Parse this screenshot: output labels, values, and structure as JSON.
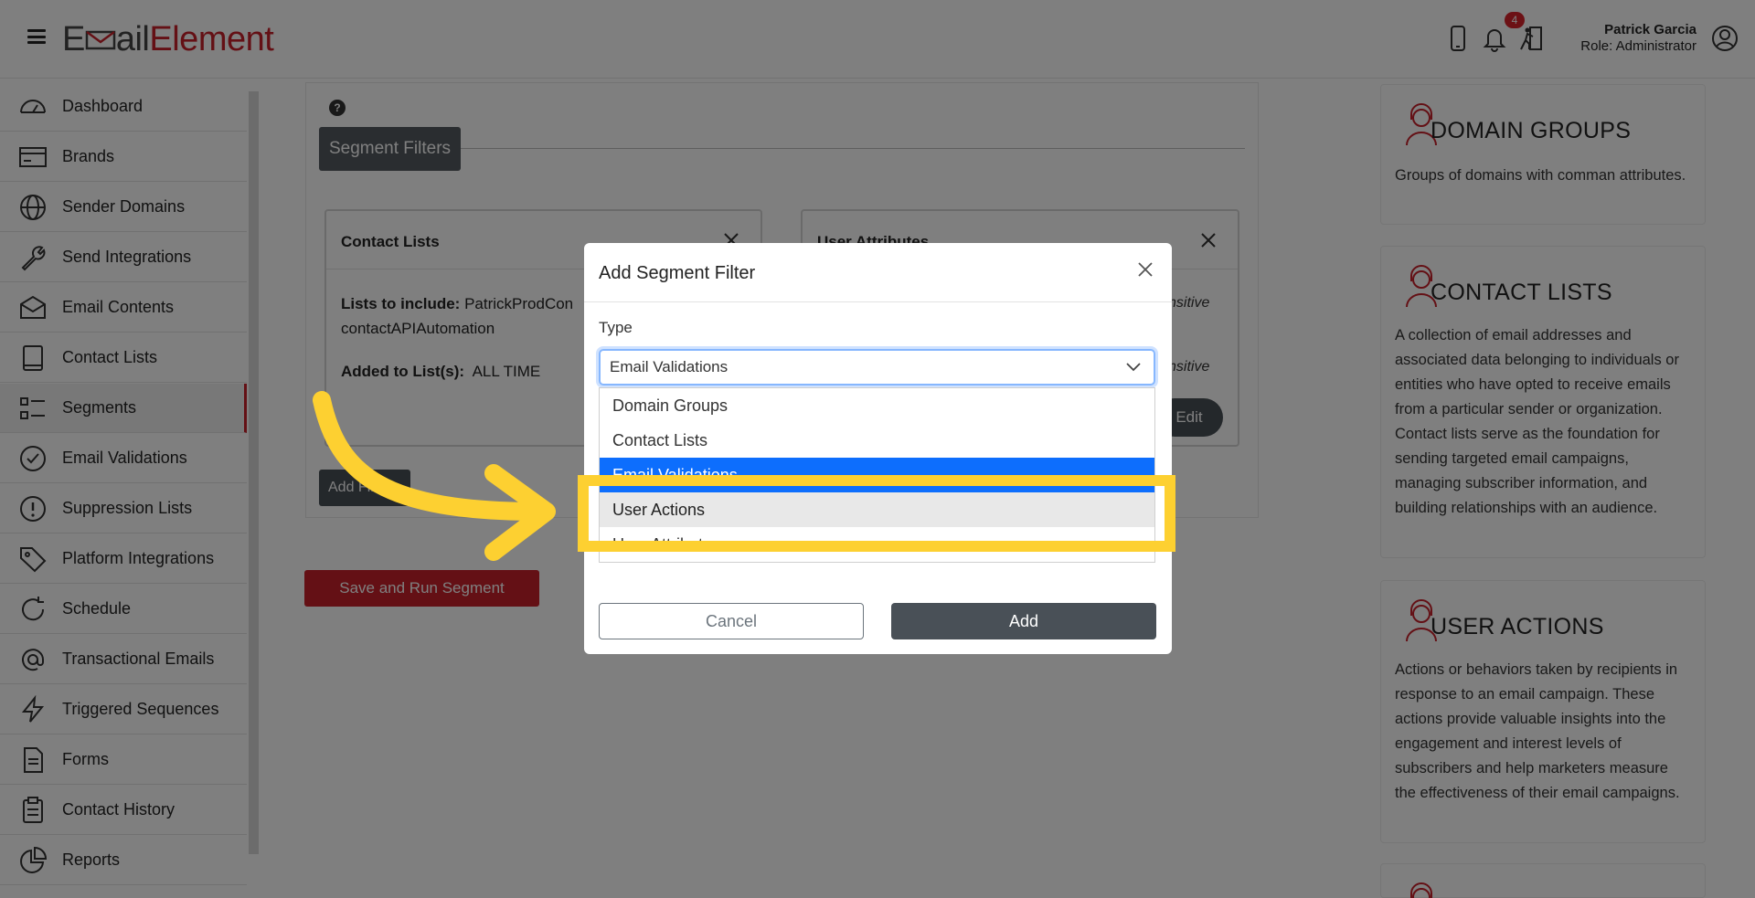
{
  "header": {
    "logo_part1": "E",
    "logo_part2": "ail",
    "logo_part3": "Element",
    "notification_count": "4",
    "user_name": "Patrick Garcia",
    "user_role": "Role: Administrator",
    "icons": [
      "phone-icon",
      "bell-icon",
      "exit-icon",
      "user-circle-icon"
    ]
  },
  "sidebar": {
    "items": [
      {
        "label": "Dashboard",
        "icon": "gauge-icon"
      },
      {
        "label": "Brands",
        "icon": "card-icon"
      },
      {
        "label": "Sender Domains",
        "icon": "globe-icon"
      },
      {
        "label": "Send Integrations",
        "icon": "wrench-icon"
      },
      {
        "label": "Email Contents",
        "icon": "envelope-icon"
      },
      {
        "label": "Contact Lists",
        "icon": "book-icon"
      },
      {
        "label": "Segments",
        "icon": "list-icon"
      },
      {
        "label": "Email Validations",
        "icon": "check-circle-icon"
      },
      {
        "label": "Suppression Lists",
        "icon": "exclamation-circle-icon"
      },
      {
        "label": "Platform Integrations",
        "icon": "tag-icon"
      },
      {
        "label": "Schedule",
        "icon": "refresh-icon"
      },
      {
        "label": "Transactional Emails",
        "icon": "at-icon"
      },
      {
        "label": "Triggered Sequences",
        "icon": "lightning-icon"
      },
      {
        "label": "Forms",
        "icon": "document-icon"
      },
      {
        "label": "Contact History",
        "icon": "clipboard-icon"
      },
      {
        "label": "Reports",
        "icon": "pie-chart-icon"
      }
    ],
    "active": "Segments"
  },
  "main": {
    "help": "?",
    "tab_label": "Segment Filters",
    "contact_card": {
      "title": "Contact Lists",
      "lists_label": "Lists to include:",
      "lists_value": "PatrickProdCon",
      "lists_value2": "contactAPIAutomation",
      "added_label": "Added to List(s):",
      "added_value": "ALL TIME"
    },
    "attr_card": {
      "title": "User Attributes",
      "sensitive1": "nsitive",
      "sensitive2": "nsitive",
      "edit_label": "Edit"
    },
    "add_filter_label": "Add Filter",
    "save_run_label": "Save and Run Segment"
  },
  "right_panel": {
    "cards": [
      {
        "title": "DOMAIN GROUPS",
        "body": "Groups of domains with comman attributes."
      },
      {
        "title": "CONTACT LISTS",
        "body": "A collection of email addresses and associated data belonging to individuals or entities who have opted to receive emails from a particular sender or organization. Contact lists serve as the foundation for sending targeted email campaigns, managing subscriber information, and building relationships with an audience."
      },
      {
        "title": "USER ACTIONS",
        "body": "Actions or behaviors taken by recipients in response to an email campaign. These actions provide valuable insights into the engagement and interest levels of subscribers and help marketers measure the effectiveness of their email campaigns."
      }
    ]
  },
  "modal": {
    "title": "Add Segment Filter",
    "type_label": "Type",
    "selected_value": "Email Validations",
    "options": [
      "Domain Groups",
      "Contact Lists",
      "Email Validations",
      "User Actions",
      "User Attributes"
    ],
    "highlighted_option": "User Actions",
    "cancel_label": "Cancel",
    "add_label": "Add"
  },
  "colors": {
    "brand_red": "#c8202a",
    "highlight_yellow": "#fdd031",
    "select_blue": "#0d6efd",
    "dark_button": "#495057"
  }
}
